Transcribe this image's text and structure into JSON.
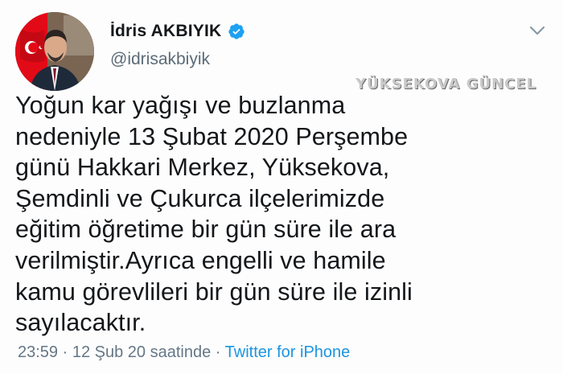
{
  "tweet": {
    "author": {
      "display_name": "İdris AKBIYIK",
      "handle": "@idrisakbiyik",
      "verified": true,
      "avatar_icon": "profile-photo-with-turkish-flag"
    },
    "watermark": "YÜKSEKOVA GÜNCEL",
    "text": "Yoğun kar yağışı ve buzlanma\nnedeniyle 13 Şubat 2020 Perşembe\ngünü Hakkari Merkez, Yüksekova,\nŞemdinli ve Çukurca ilçelerimizde\neğitim öğretime bir gün süre ile ara\nverilmiştir.Ayrıca engelli ve hamile\nkamu görevlileri bir gün süre ile izinli\nsayılacaktır.",
    "time": "23:59",
    "separator": "·",
    "date": "12 Şub 20 saatinde",
    "source": "Twitter for iPhone"
  },
  "colors": {
    "text": "#14171a",
    "secondary": "#657786",
    "link": "#1b95e0",
    "verified": "#1da1f2",
    "flag_red": "#e30a17"
  }
}
